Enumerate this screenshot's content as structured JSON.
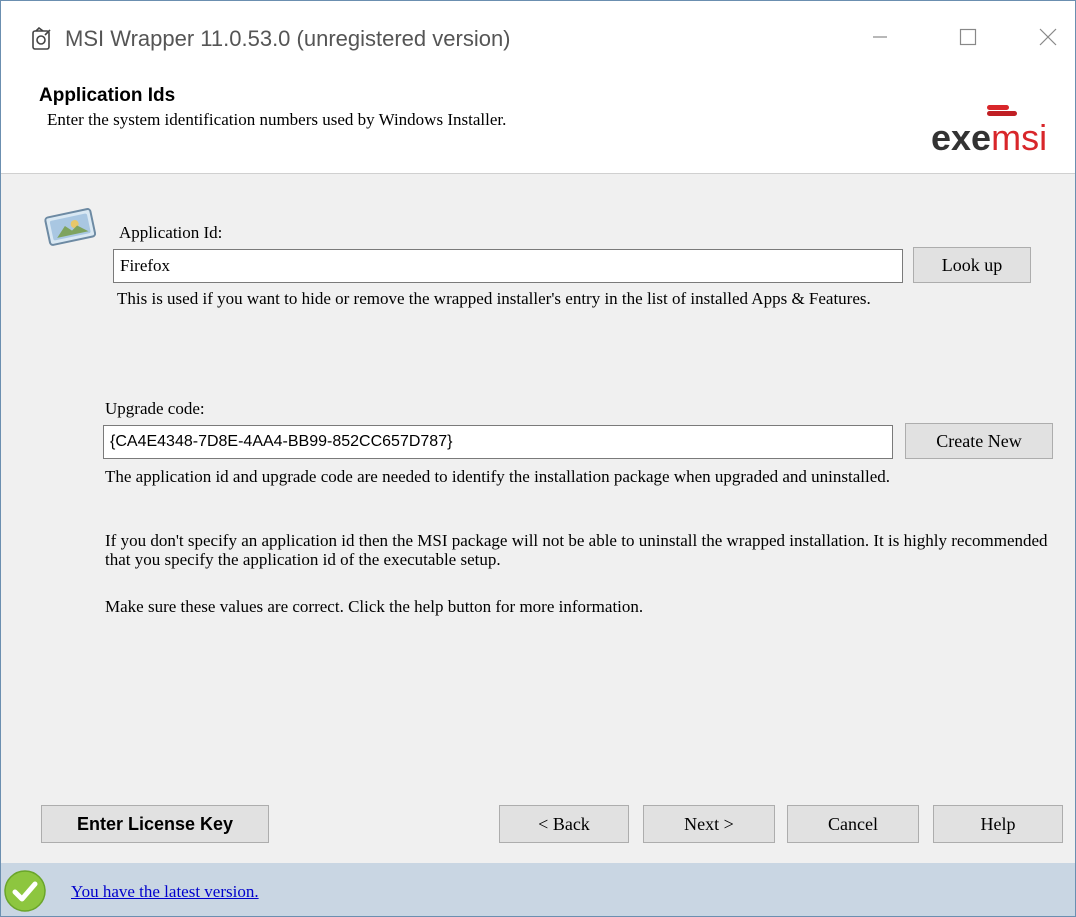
{
  "window": {
    "title": "MSI Wrapper 11.0.53.0 (unregistered version)",
    "icon": "msi-wrapper-app-icon"
  },
  "header": {
    "title": "Application Ids",
    "subtitle": "Enter the system identification numbers used by Windows Installer.",
    "logo": {
      "exe": "exe",
      "msi": "msi"
    }
  },
  "app_id": {
    "label": "Application Id:",
    "value": "Firefox",
    "lookup_button": "Look up",
    "hint": "This is used if you want to hide or remove the wrapped installer's entry in the list of installed Apps & Features."
  },
  "upgrade": {
    "label": "Upgrade code:",
    "value": "{CA4E4348-7D8E-4AA4-BB99-852CC657D787}",
    "create_button": "Create New",
    "hint": "The application id and upgrade code are needed to identify the installation package when upgraded and uninstalled."
  },
  "info": {
    "para1": "If you don't specify an application id then the MSI package will not be able to uninstall the wrapped installation. It is highly recommended that you specify the application id of the executable setup.",
    "para2": "Make sure these values are correct. Click the help button for more information."
  },
  "buttons": {
    "license": "Enter License Key",
    "back": "< Back",
    "next": "Next >",
    "cancel": "Cancel",
    "help": "Help"
  },
  "footer": {
    "status_link": "You have the latest version."
  },
  "colors": {
    "footer_bg": "#c9d6e3",
    "logo_red": "#d8262a",
    "link": "#0000cc"
  }
}
